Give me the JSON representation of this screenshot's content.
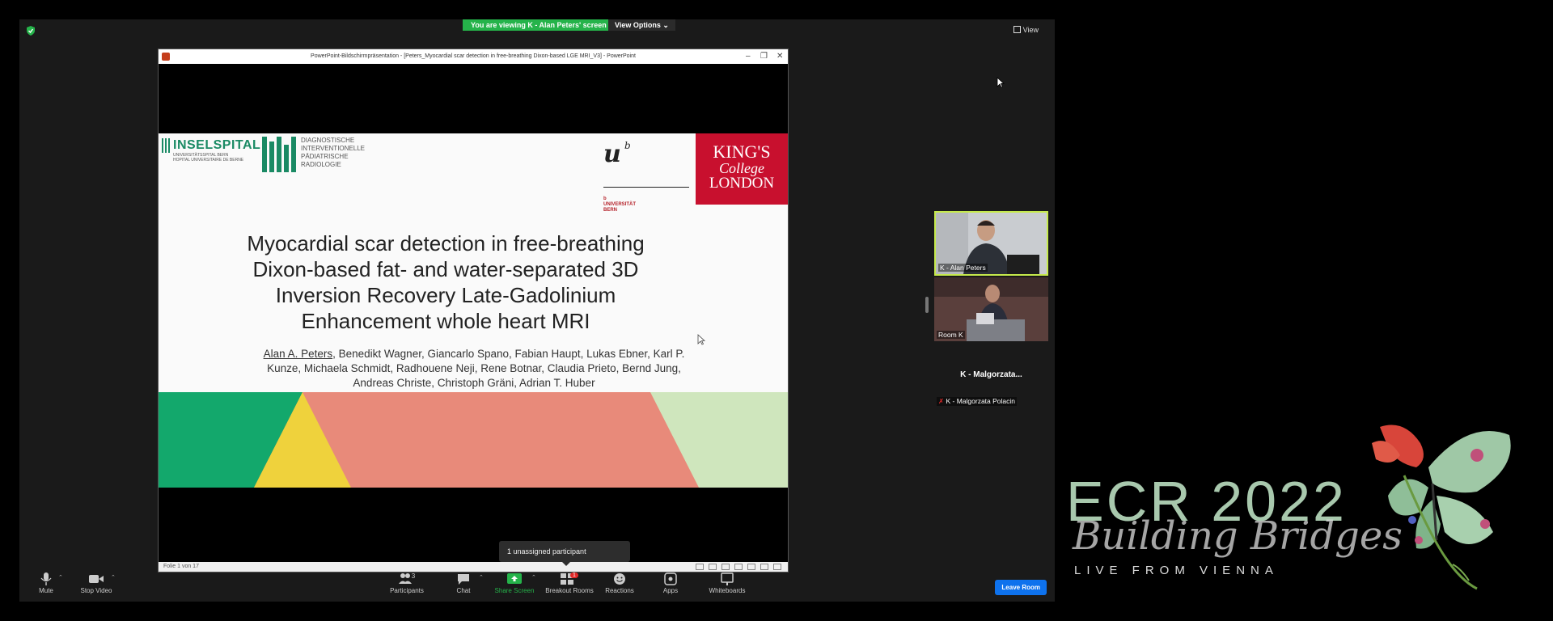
{
  "zoom": {
    "viewing_banner": "You are viewing K - Alan Peters' screen",
    "view_options": "View Options",
    "view_button": "View",
    "tooltip": "1 unassigned participant",
    "toolbar": {
      "mute": "Mute",
      "stop_video": "Stop Video",
      "participants": "Participants",
      "participants_count": "3",
      "chat": "Chat",
      "share_screen": "Share Screen",
      "breakout_rooms": "Breakout Rooms",
      "breakout_badge": "1",
      "reactions": "Reactions",
      "apps": "Apps",
      "whiteboards": "Whiteboards",
      "leave_room": "Leave Room"
    },
    "tiles": [
      {
        "name": "K - Alan Peters"
      },
      {
        "name": "Room K"
      },
      {
        "name": "K - Malgorzata Polacin",
        "display": "K - Malgorzata..."
      }
    ]
  },
  "powerpoint": {
    "window_title": "PowerPoint-Bildschirmpräsentation - [Peters_Myocardial scar detection in free-breathing Dixon-based LGE MRI_V3] - PowerPoint",
    "slide_counter": "Folie 1 von 17",
    "controls": {
      "minimize": "–",
      "restore": "❐",
      "close": "✕"
    },
    "slide": {
      "inselspital": "INSELSPITAL",
      "inselspital_sub1": "UNIVERSITÄTSSPITAL BERN",
      "inselspital_sub2": "HOPITAL UNIVERSITAIRE DE BERNE",
      "diag_text": "DIAGNOSTISCHE\nINTERVENTIONELLE\nPÄDIATRISCHE\nRADIOLOGIE",
      "unibern_u": "u",
      "unibern_b": "b",
      "unibern_name": "b\nUNIVERSITÄT\nBERN",
      "kcl_l1": "KING'S",
      "kcl_l2": "College",
      "kcl_l3": "LONDON",
      "title": "Myocardial scar detection in free-breathing Dixon-based fat- and water-separated 3D Inversion Recovery Late-Gadolinium Enhancement whole heart MRI",
      "presenter": "Alan A. Peters",
      "coauthors": ", Benedikt Wagner, Giancarlo Spano, Fabian Haupt, Lukas Ebner, Karl P. Kunze, Michaela Schmidt, Radhouene Neji, Rene Botnar, Claudia Prieto, Bernd Jung, Andreas Christe, Christoph Gräni, Adrian T. Huber"
    }
  },
  "branding": {
    "ecr": "ECR 2022",
    "tagline": "Building Bridges",
    "live": "LIVE FROM VIENNA"
  },
  "colors": {
    "zoom_green": "#25b34a",
    "kcl_red": "#c8102e",
    "insel_green": "#1a8a64",
    "band_green": "#13a86c",
    "band_yellow": "#efd23c",
    "band_salmon": "#e88a7a",
    "band_lightgreen": "#cfe6bd",
    "leave_blue": "#0e72ed"
  }
}
